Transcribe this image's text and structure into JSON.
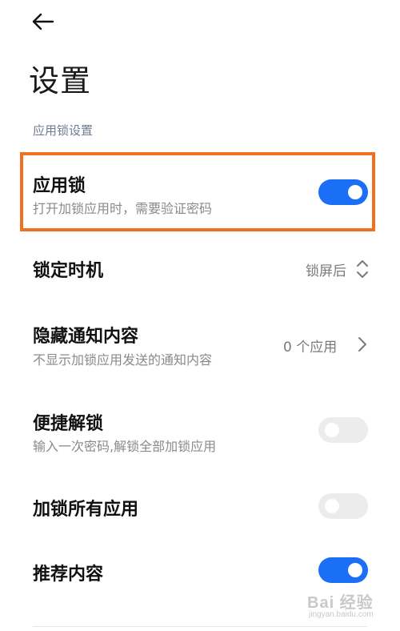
{
  "header": {
    "back_icon": "arrow-left-icon",
    "title": "设置"
  },
  "section": {
    "label": "应用锁设置"
  },
  "settings": [
    {
      "title": "应用锁",
      "subtitle": "打开加锁应用时，需要验证密码",
      "control": "toggle",
      "enabled": true,
      "highlighted": true
    },
    {
      "title": "锁定时机",
      "control": "select",
      "value": "锁屏后",
      "icon": "up-down-chevron-icon"
    },
    {
      "title": "隐藏通知内容",
      "subtitle": "不显示加锁应用发送的通知内容",
      "control": "link",
      "value": "0 个应用",
      "icon": "chevron-right-icon"
    },
    {
      "title": "便捷解锁",
      "subtitle": "输入一次密码,解锁全部加锁应用",
      "control": "toggle",
      "enabled": false,
      "disabled": true
    },
    {
      "title": "加锁所有应用",
      "control": "toggle",
      "enabled": false,
      "disabled": true
    },
    {
      "title": "推荐内容",
      "control": "toggle",
      "enabled": true
    }
  ],
  "watermark": {
    "main": "Bai 经验",
    "sub": "jingyan.baidu.com"
  },
  "colors": {
    "accent": "#1b6ef6",
    "highlight": "#f07022",
    "section_label": "#6e7c95",
    "subtitle": "#8a8a8a",
    "toggle_off": "#ececec"
  }
}
